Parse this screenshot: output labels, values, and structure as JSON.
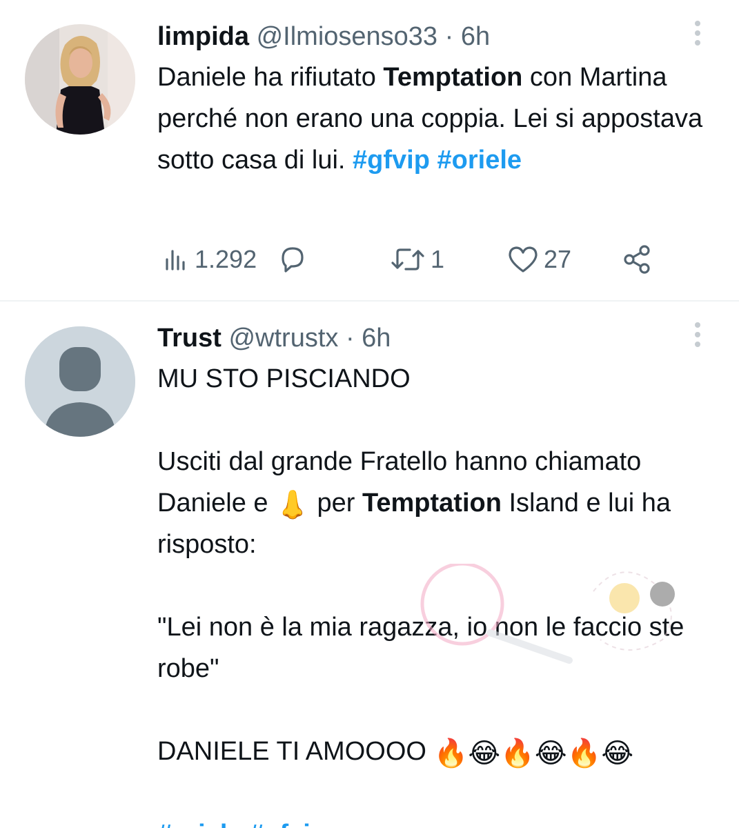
{
  "tweets": [
    {
      "name": "limpida",
      "handle": "@Ilmiosenso33",
      "sep": "·",
      "time": "6h",
      "text_parts": [
        "Daniele ha rifiutato ",
        "Temptation",
        " con Martina perché non erano una coppia. Lei si appostava sotto casa di lui. ",
        "#gfvip",
        " ",
        "#oriele"
      ],
      "stats": {
        "views": "1.292",
        "replies": "",
        "retweets": "1",
        "likes": "27"
      },
      "icons": {
        "views": "analytics-icon",
        "reply": "reply-icon",
        "retweet": "retweet-icon",
        "like": "heart-icon",
        "share": "share-icon",
        "more": "more-vertical-icon"
      }
    },
    {
      "name": "Trust",
      "handle": "@wtrustx",
      "sep": "·",
      "time": "6h",
      "line1": "MU STO PISCIANDO",
      "p2_a": "Usciti dal grande Fratello hanno chiamato Daniele e ",
      "p2_emoji": "👃",
      "p2_b": " per ",
      "p2_bold": "Temptation",
      "p2_c": " Island e lui ha risposto:",
      "quote": "\"Lei non è la mia ragazza, io non le faccio ste robe\"",
      "line4": "DANIELE TI AMOOOO",
      "emojis": "🔥😂🔥😂🔥😂",
      "hashtags": [
        "#oriele",
        "#gfvip"
      ]
    }
  ],
  "colors": {
    "text": "#0f1419",
    "secondary": "#536471",
    "link": "#1d9bf0",
    "divider": "#eff3f4",
    "default_avatar": "#ccd6dd"
  }
}
